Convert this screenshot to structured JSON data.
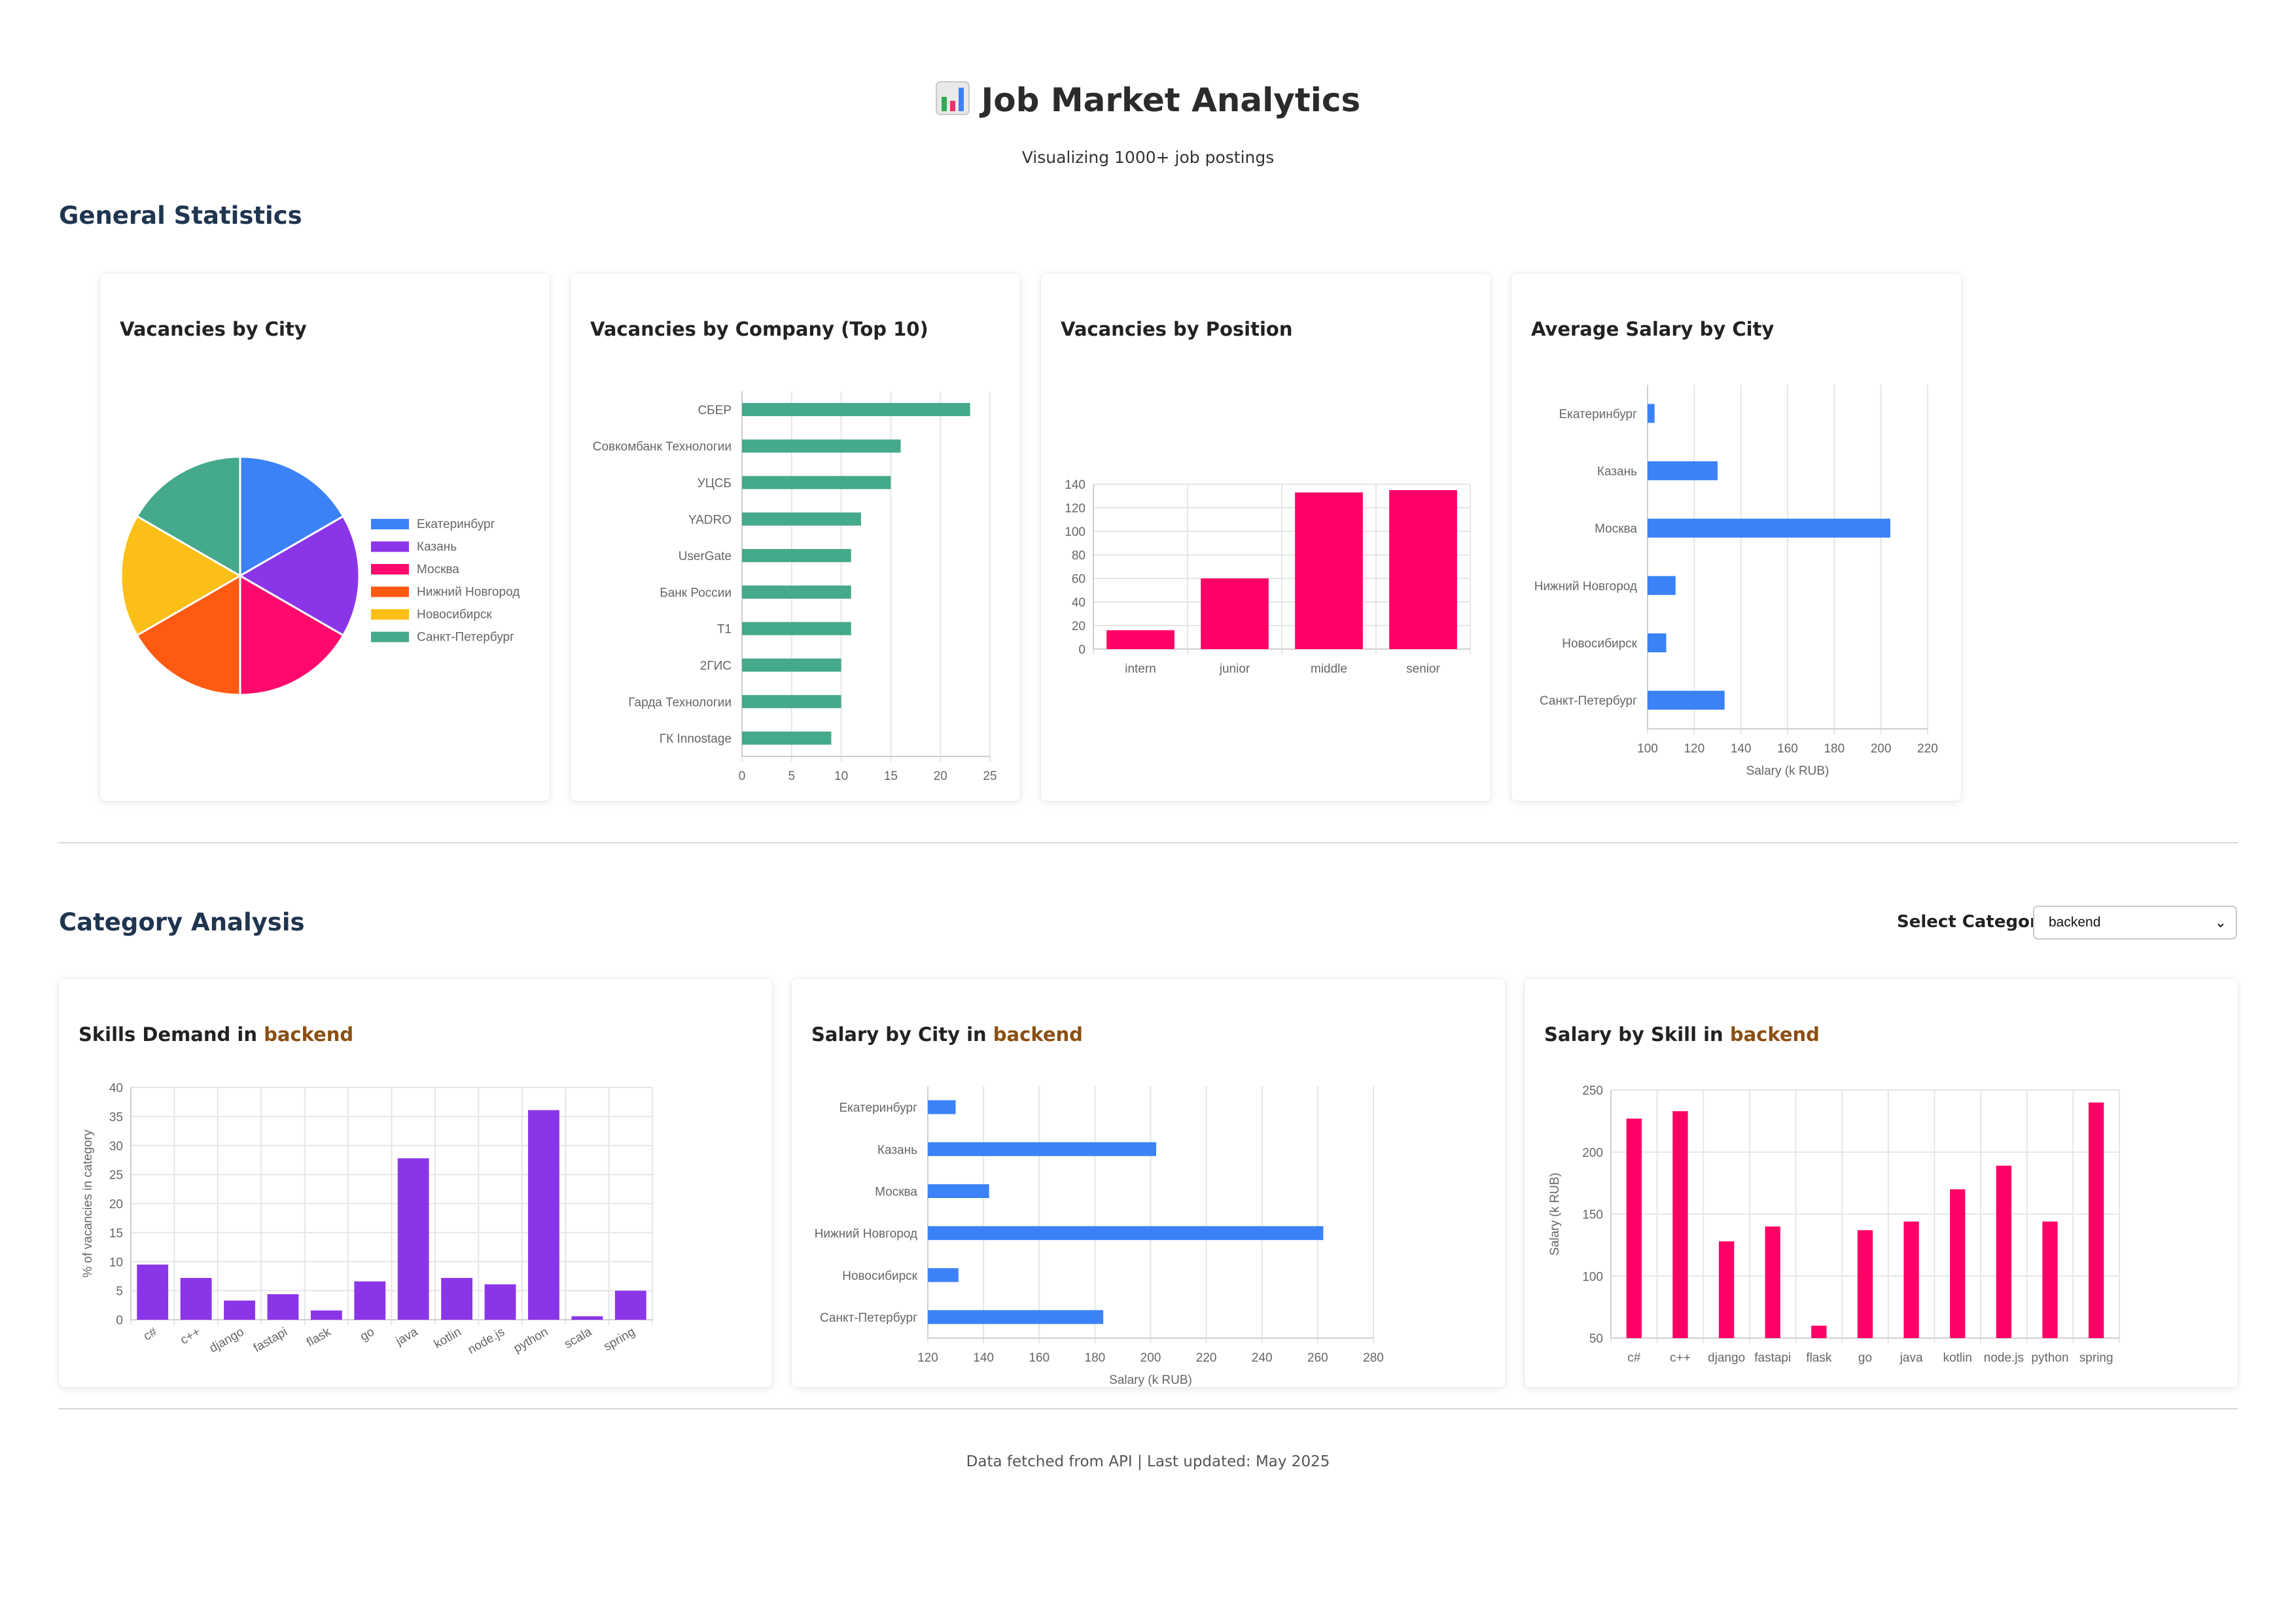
{
  "header": {
    "title": "Job Market Analytics",
    "subtitle": "Visualizing 1000+ job postings",
    "logo_icon": "bar-chart-icon"
  },
  "sections": {
    "general": "General Statistics",
    "category": "Category Analysis"
  },
  "category_select": {
    "label": "Select Category:",
    "value": "backend"
  },
  "footer": "Data fetched from API | Last updated: May 2025",
  "cards": {
    "city_pie": {
      "title": "Vacancies by City"
    },
    "company": {
      "title": "Vacancies by Company (Top 10)"
    },
    "position": {
      "title": "Vacancies by Position"
    },
    "salary_city": {
      "title": "Average Salary by City"
    },
    "skills": {
      "title_prefix": "Skills Demand in ",
      "category": "backend"
    },
    "cat_salary_city": {
      "title_prefix": "Salary by City in ",
      "category": "backend"
    },
    "cat_salary_skill": {
      "title_prefix": "Salary by Skill in ",
      "category": "backend"
    }
  },
  "colors": {
    "blue": "#3b82f6",
    "purple": "#8b35e8",
    "pink": "#ff0066",
    "green": "#45a98b",
    "orange": "#ff5a12",
    "yellow": "#fbbf18",
    "accent_text": "#8a4f12"
  },
  "chart_data": [
    {
      "id": "city_pie",
      "type": "pie",
      "title": "Vacancies by City",
      "labels": [
        "Екатеринбург",
        "Казань",
        "Москва",
        "Нижний Новгород",
        "Новосибирск",
        "Санкт-Петербург"
      ],
      "values": [
        16.7,
        16.7,
        16.7,
        16.7,
        16.7,
        16.7
      ],
      "colors": [
        "#3b82f6",
        "#8b35e8",
        "#ff0a6c",
        "#ff5a12",
        "#fbbf18",
        "#45a98b"
      ],
      "legend": "right"
    },
    {
      "id": "company",
      "type": "bar",
      "orientation": "horizontal",
      "title": "Vacancies by Company (Top 10)",
      "categories": [
        "СБЕР",
        "Совкомбанк Технологии",
        "УЦСБ",
        "YADRO",
        "UserGate",
        "Банк России",
        "Т1",
        "2ГИС",
        "Гарда Технологии",
        "ГК Innostage"
      ],
      "values": [
        23,
        16,
        15,
        12,
        11,
        11,
        11,
        10,
        10,
        9
      ],
      "xlim": [
        0,
        25
      ],
      "xticks": [
        0,
        5,
        10,
        15,
        20,
        25
      ],
      "color": "#45a98b",
      "grid": true
    },
    {
      "id": "position",
      "type": "bar",
      "title": "Vacancies by Position",
      "categories": [
        "intern",
        "junior",
        "middle",
        "senior"
      ],
      "values": [
        16,
        60,
        133,
        135
      ],
      "ylim": [
        0,
        140
      ],
      "yticks": [
        0,
        20,
        40,
        60,
        80,
        100,
        120,
        140
      ],
      "color": "#ff0066",
      "grid": true
    },
    {
      "id": "salary_city",
      "type": "bar",
      "orientation": "horizontal",
      "title": "Average Salary by City",
      "categories": [
        "Екатеринбург",
        "Казань",
        "Москва",
        "Нижний Новгород",
        "Новосибирск",
        "Санкт-Петербург"
      ],
      "values": [
        103,
        130,
        204,
        112,
        108,
        133
      ],
      "xlim": [
        100,
        220
      ],
      "xticks": [
        100,
        120,
        140,
        160,
        180,
        200,
        220
      ],
      "xlabel": "Salary (k RUB)",
      "color": "#3b82f6",
      "grid": true
    },
    {
      "id": "skills",
      "type": "bar",
      "title": "Skills Demand in backend",
      "categories": [
        "c#",
        "c++",
        "django",
        "fastapi",
        "flask",
        "go",
        "java",
        "kotlin",
        "node.js",
        "python",
        "scala",
        "spring"
      ],
      "values": [
        9.5,
        7.2,
        3.3,
        4.4,
        1.6,
        6.6,
        27.8,
        7.2,
        6.1,
        36.1,
        0.6,
        5.0
      ],
      "ylim": [
        0,
        40
      ],
      "yticks": [
        0,
        5,
        10,
        15,
        20,
        25,
        30,
        35,
        40
      ],
      "ylabel": "% of vacancies in category",
      "color": "#8b35e8",
      "grid": true
    },
    {
      "id": "cat_salary_city",
      "type": "bar",
      "orientation": "horizontal",
      "title": "Salary by City in backend",
      "categories": [
        "Екатеринбург",
        "Казань",
        "Москва",
        "Нижний Новгород",
        "Новосибирск",
        "Санкт-Петербург"
      ],
      "values": [
        130,
        202,
        142,
        262,
        131,
        183
      ],
      "xlim": [
        120,
        280
      ],
      "xticks": [
        120,
        140,
        160,
        180,
        200,
        220,
        240,
        260,
        280
      ],
      "xlabel": "Salary (k RUB)",
      "color": "#3b82f6",
      "grid": true
    },
    {
      "id": "cat_salary_skill",
      "type": "bar",
      "title": "Salary by Skill in backend",
      "categories": [
        "c#",
        "c++",
        "django",
        "fastapi",
        "flask",
        "go",
        "java",
        "kotlin",
        "node.js",
        "python",
        "spring"
      ],
      "values": [
        227,
        233,
        128,
        140,
        60,
        137,
        144,
        170,
        189,
        144,
        240
      ],
      "ylim": [
        50,
        250
      ],
      "yticks": [
        50,
        100,
        150,
        200,
        250
      ],
      "ylabel": "Salary (k RUB)",
      "color": "#ff0066",
      "grid": true
    }
  ]
}
